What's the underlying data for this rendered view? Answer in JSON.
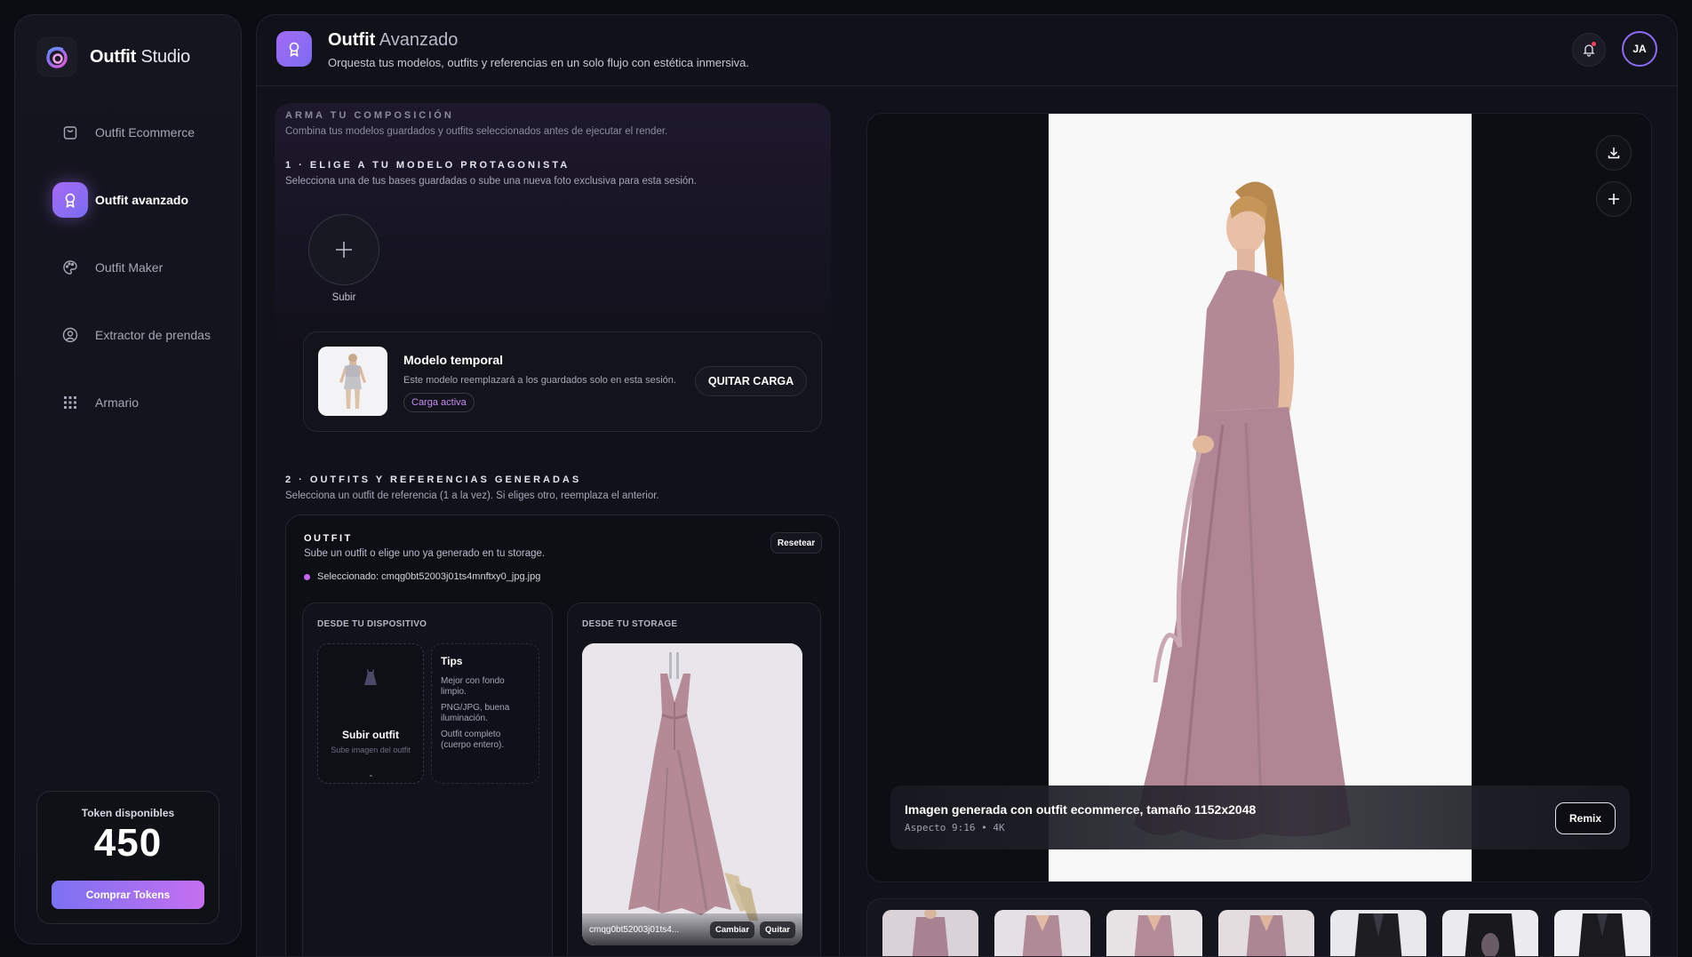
{
  "brand": {
    "name_bold": "Outfit",
    "name_light": "Studio"
  },
  "sidebar": {
    "items": [
      {
        "label": "Outfit Ecommerce",
        "icon": "bag-icon",
        "active": false
      },
      {
        "label": "Outfit avanzado",
        "icon": "award-icon",
        "active": true
      },
      {
        "label": "Outfit Maker",
        "icon": "palette-icon",
        "active": false
      },
      {
        "label": "Extractor de prendas",
        "icon": "user-circle-icon",
        "active": false
      },
      {
        "label": "Armario",
        "icon": "grid-icon",
        "active": false
      }
    ],
    "tokens": {
      "label": "Token disponibles",
      "value": "450",
      "button": "Comprar Tokens"
    }
  },
  "header": {
    "title_bold": "Outfit",
    "title_light": "Avanzado",
    "subtitle": "Orquesta tus modelos, outfits y referencias en un solo flujo con estética inmersiva.",
    "avatar": "JA"
  },
  "compose": {
    "kicker": "ARMA TU COMPOSICIÓN",
    "description": "Combina tus modelos guardados y outfits seleccionados antes de ejecutar el render.",
    "step1": {
      "title": "1 · ELIGE A TU MODELO PROTAGONISTA",
      "description": "Selecciona una de tus bases guardadas o sube una nueva foto exclusiva para esta sesión.",
      "upload_label": "Subir",
      "temp_title": "Modelo temporal",
      "temp_desc": "Este modelo reemplazará a los guardados solo en esta sesión.",
      "temp_badge": "Carga activa",
      "temp_button": "QUITAR CARGA"
    },
    "step2": {
      "title": "2 · OUTFITS Y REFERENCIAS GENERADAS",
      "description": "Selecciona un outfit de referencia (1 a la vez). Si eliges otro, reemplaza el anterior.",
      "outfit": {
        "kicker": "OUTFIT",
        "description": "Sube un outfit o elige uno ya generado en tu storage.",
        "reset": "Resetear",
        "selected": "Seleccionado: cmqg0bt52003j01ts4mnftxy0_jpg.jpg",
        "device": {
          "kicker": "DESDE TU DISPOSITIVO",
          "drop_title": "Subir outfit",
          "drop_sub": "Sube imagen del outfit",
          "tips_title": "Tips",
          "tips": [
            "Mejor con fondo limpio.",
            "PNG/JPG, buena iluminación.",
            "Outfit completo (cuerpo entero)."
          ]
        },
        "storage": {
          "kicker": "DESDE TU STORAGE",
          "filename": "cmqg0bt52003j01ts4...",
          "change": "Cambiar",
          "remove": "Quitar"
        }
      }
    }
  },
  "preview": {
    "caption_title": "Imagen generada con outfit ecommerce, tamaño 1152x2048",
    "caption_meta": "Aspecto 9:16 • 4K",
    "remix": "Remix"
  },
  "colors": {
    "accent": "#a46bf5",
    "accent_alt": "#7a6cf0",
    "dress": "#b38a96",
    "background": "#0b0b12"
  }
}
